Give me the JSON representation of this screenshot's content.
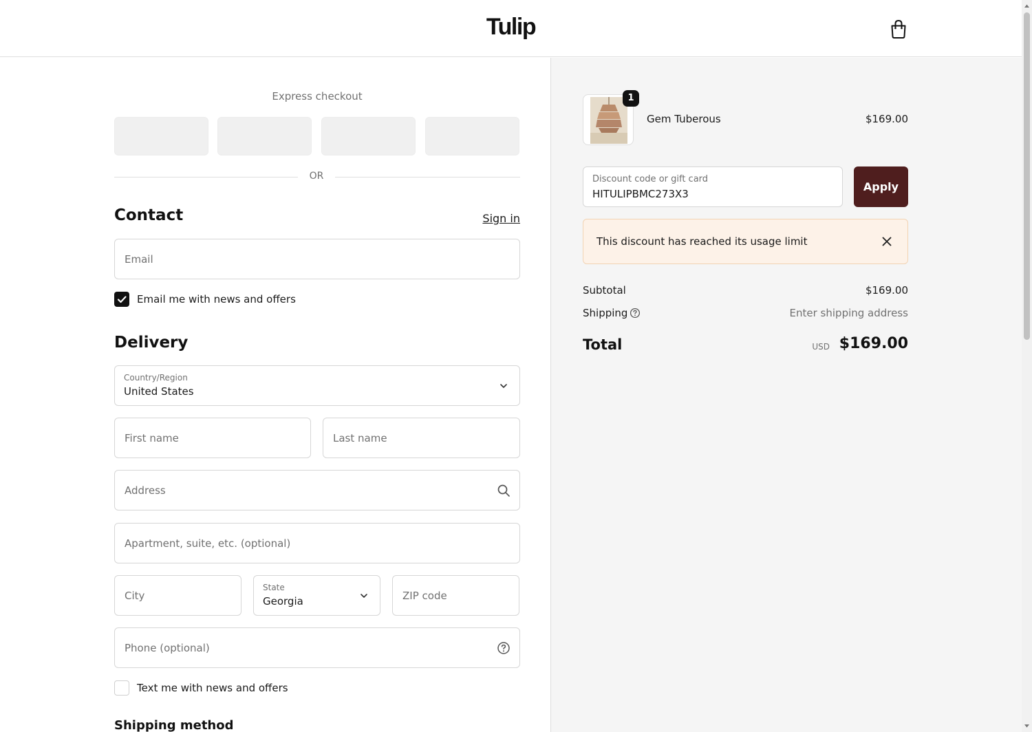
{
  "header": {
    "logo": "Tulip",
    "cart_icon": "shopping-bag-icon"
  },
  "express": {
    "label": "Express checkout",
    "or_label": "OR"
  },
  "contact": {
    "title": "Contact",
    "sign_in": "Sign in",
    "email_placeholder": "Email",
    "marketing_label": "Email me with news and offers",
    "marketing_checked": true
  },
  "delivery": {
    "title": "Delivery",
    "country_label": "Country/Region",
    "country_value": "United States",
    "first_name_placeholder": "First name",
    "last_name_placeholder": "Last name",
    "address_placeholder": "Address",
    "apartment_placeholder": "Apartment, suite, etc. (optional)",
    "city_placeholder": "City",
    "state_label": "State",
    "state_value": "Georgia",
    "zip_placeholder": "ZIP code",
    "phone_placeholder": "Phone (optional)",
    "sms_label": "Text me with news and offers",
    "sms_checked": false
  },
  "shipping_method": {
    "title": "Shipping method"
  },
  "order": {
    "item": {
      "name": "Gem Tuberous",
      "price": "$169.00",
      "quantity": "1"
    },
    "discount": {
      "label": "Discount code or gift card",
      "value": "HITULIPBMC273X3",
      "apply_label": "Apply"
    },
    "alert": {
      "message": "This discount has reached its usage limit"
    },
    "subtotal_label": "Subtotal",
    "subtotal_value": "$169.00",
    "shipping_label": "Shipping",
    "shipping_value": "Enter shipping address",
    "total_label": "Total",
    "total_currency": "USD",
    "total_value": "$169.00"
  },
  "colors": {
    "apply_button": "#4f1e1e",
    "alert_background": "#fdf2e8",
    "summary_background": "#f5f5f5"
  }
}
